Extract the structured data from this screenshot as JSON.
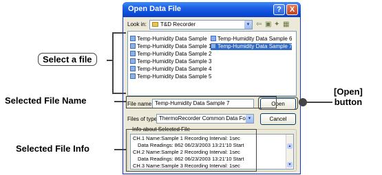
{
  "dialog": {
    "title": "Open Data File",
    "help_btn": "?",
    "close_btn": "X",
    "look_in_label": "Look in:",
    "look_in_value": "T&D Recorder",
    "files_left": [
      "Temp-Humidity Data Sample",
      "Temp-Humidity Data Sample 1",
      "Temp-Humidity Data Sample 2",
      "Temp-Humidity Data Sample 3",
      "Temp-Humidity Data Sample 4",
      "Temp-Humidity Data Sample 5"
    ],
    "files_right": [
      "Temp-Humidity Data Sample 6",
      "Temp-Humidity Data Sample 7"
    ],
    "file_name_label": "File name:",
    "file_name_value": "Temp-Humidity Data Sample 7",
    "files_of_type_label": "Files of type:",
    "files_of_type_value": "ThermoRecorder Common Data Format(*.trx)",
    "open_btn": "Open",
    "cancel_btn": "Cancel",
    "info_title": "Info about Selected File",
    "info_lines": [
      "CH.1 Name:Sample 1   Recording Interval:  1sec",
      "Data Readings: 862      06/23/2003 13:21'10 Start",
      "CH.2 Name:Sample 2   Recording Interval:  1sec",
      "Data Readings: 862      06/23/2003 13:21'10 Start",
      "CH.3 Name:Sample 3   Recording Interval:  1sec"
    ]
  },
  "callouts": {
    "select_file": "Select a file",
    "selected_file_name": "Selected File Name",
    "open_button_line1": "[Open]",
    "open_button_line2": "button",
    "selected_file_info": "Selected File Info"
  },
  "colors": {
    "titlebar": "#0a49d8",
    "selection": "#316ac5",
    "dialog_bg": "#ece9d8"
  }
}
